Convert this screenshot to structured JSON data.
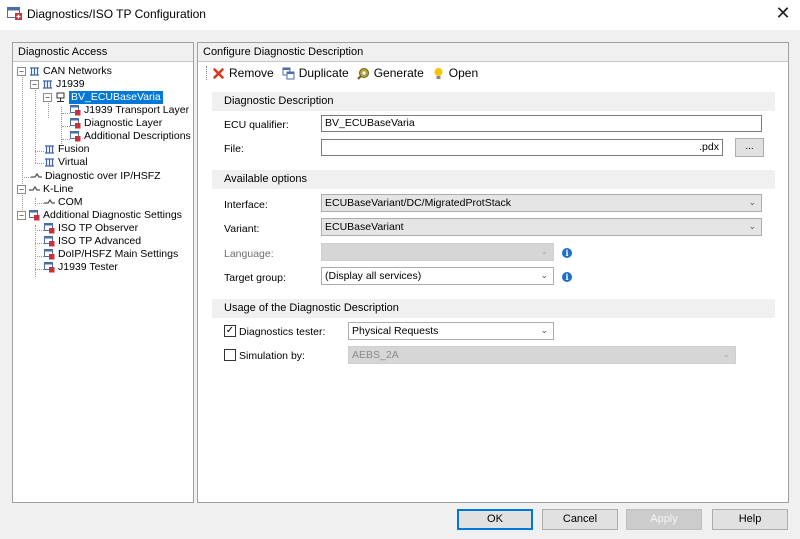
{
  "window": {
    "title": "Diagnostics/ISO TP Configuration",
    "close_glyph": "✕"
  },
  "left_panel": {
    "header": "Diagnostic Access",
    "tree": {
      "can_networks": "CAN Networks",
      "j1939": "J1939",
      "bv_ecu": "BV_ECUBaseVaria",
      "j1939_transport": "J1939 Transport Layer",
      "diagnostic_layer": "Diagnostic Layer",
      "additional_descriptions": "Additional Descriptions",
      "fusion": "Fusion",
      "virtual": "Virtual",
      "diag_over_ip": "Diagnostic over IP/HSFZ",
      "kline": "K-Line",
      "com": "COM",
      "additional_diag_settings": "Additional Diagnostic Settings",
      "iso_tp_observer": "ISO TP Observer",
      "iso_tp_advanced": "ISO TP Advanced",
      "doip_main": "DoIP/HSFZ Main Settings",
      "j1939_tester": "J1939 Tester"
    }
  },
  "right_panel": {
    "header": "Configure Diagnostic Description",
    "toolbar": {
      "remove": "Remove",
      "duplicate": "Duplicate",
      "generate": "Generate",
      "open": "Open"
    },
    "diag_description": {
      "title": "Diagnostic Description",
      "ecu_qualifier_label": "ECU qualifier:",
      "ecu_qualifier_value": "BV_ECUBaseVaria",
      "file_label": "File:",
      "file_value": "",
      "file_ext": ".pdx",
      "browse": "..."
    },
    "available_options": {
      "title": "Available options",
      "interface_label": "Interface:",
      "interface_value": "ECUBaseVariant/DC/MigratedProtStack",
      "variant_label": "Variant:",
      "variant_value": "ECUBaseVariant",
      "language_label": "Language:",
      "language_value": "",
      "target_group_label": "Target group:",
      "target_group_value": "(Display all services)",
      "info": "i"
    },
    "usage": {
      "title": "Usage of the Diagnostic Description",
      "diag_tester_label": "Diagnostics tester:",
      "diag_tester_checked": "✓",
      "diag_tester_value": "Physical Requests",
      "simulation_label": "Simulation by:",
      "simulation_value": "AEBS_2A"
    }
  },
  "buttons": {
    "ok": "OK",
    "cancel": "Cancel",
    "apply": "Apply",
    "help": "Help"
  },
  "chevron": "⌄",
  "colors": {
    "selection": "#0078d7",
    "info": "#1f6fc5",
    "remove": "#d9381e"
  }
}
